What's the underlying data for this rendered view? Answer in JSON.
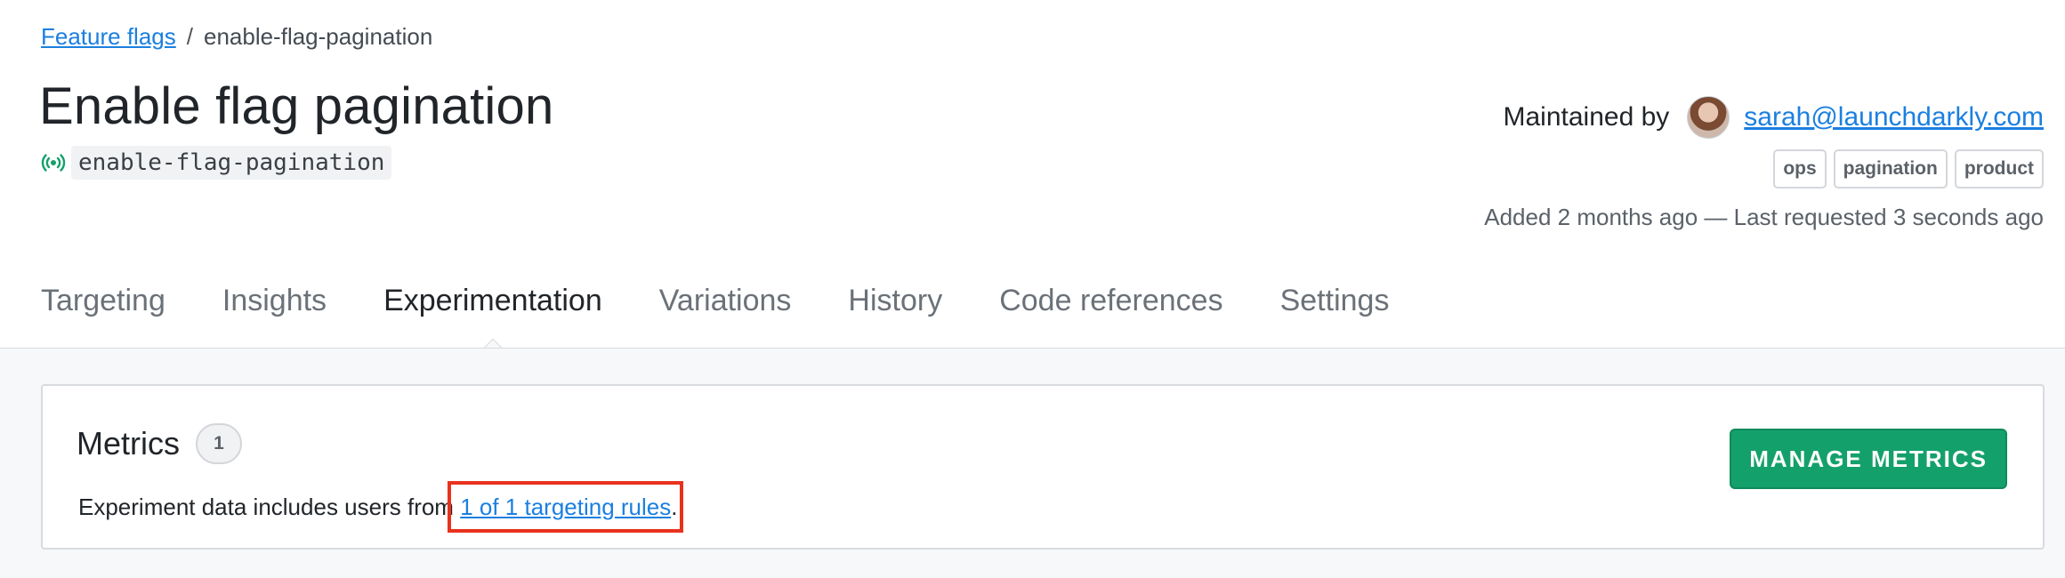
{
  "breadcrumb": {
    "parent_link": "Feature flags",
    "separator": "/",
    "current": "enable-flag-pagination"
  },
  "flag": {
    "title": "Enable flag pagination",
    "key": "enable-flag-pagination",
    "status_icon": "live-signal-icon"
  },
  "maintainer": {
    "label": "Maintained by",
    "email": "sarah@launchdarkly.com",
    "avatar": "user-avatar"
  },
  "tags": [
    "ops",
    "pagination",
    "product"
  ],
  "activity": "Added 2 months ago — Last requested 3 seconds ago",
  "tabs": [
    {
      "label": "Targeting"
    },
    {
      "label": "Insights"
    },
    {
      "label": "Experimentation",
      "active": true
    },
    {
      "label": "Variations"
    },
    {
      "label": "History"
    },
    {
      "label": "Code references"
    },
    {
      "label": "Settings"
    }
  ],
  "metrics": {
    "title": "Metrics",
    "count": "1",
    "text_prefix": "Experiment data includes users from",
    "rules_link": "1 of 1 targeting rules",
    "text_suffix": ".",
    "manage_button": "MANAGE METRICS"
  },
  "colors": {
    "link": "#1b7fe0",
    "primary_button": "#14a06b",
    "highlight_box": "#e8321d"
  }
}
